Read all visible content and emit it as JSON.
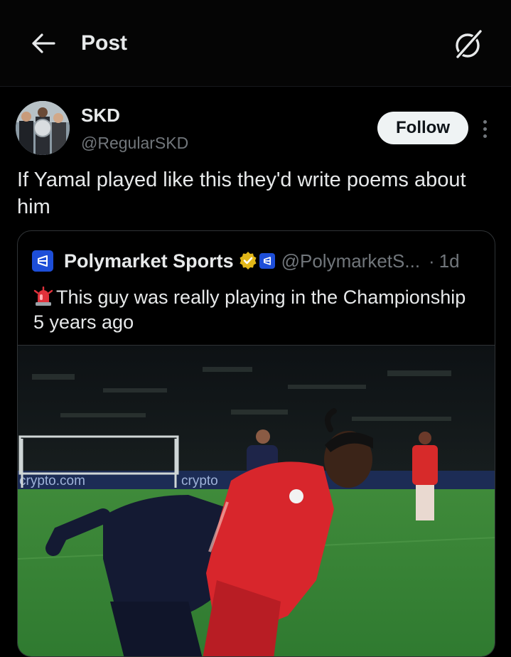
{
  "header": {
    "title": "Post",
    "back_icon": "arrow-left-icon",
    "grok_icon": "grok-icon"
  },
  "author": {
    "name": "SKD",
    "handle": "@RegularSKD",
    "follow_label": "Follow"
  },
  "post": {
    "text": "If Yamal played like this they'd write poems about him"
  },
  "quote": {
    "name": "Polymarket Sports",
    "handle": "@PolymarketS...",
    "separator": "·",
    "time": "1d",
    "text": "This guy was really playing in the Championship 5 years ago",
    "emoji": "police-car-light-icon"
  },
  "media": {
    "ad_board_left": "crypto.com",
    "ad_board_mid": "crypto"
  },
  "colors": {
    "background": "#000000",
    "text": "#e7e9ea",
    "secondary": "#71767b",
    "border": "#2f3336",
    "follow_bg": "#eff3f4",
    "brand_blue": "#1d4ed8"
  }
}
